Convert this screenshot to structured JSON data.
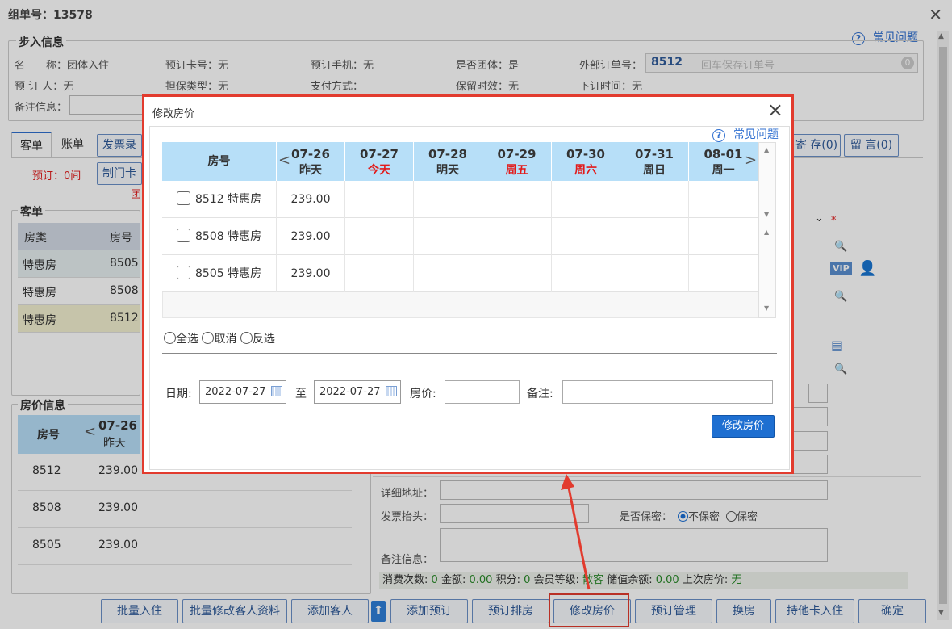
{
  "window": {
    "title": "组单号：13578"
  },
  "help_link": "常见问题",
  "step_info": {
    "title": "步入信息",
    "fields": [
      {
        "label": "名　　称：",
        "value": "团体入住"
      },
      {
        "label": "预订卡号：",
        "value": "无"
      },
      {
        "label": "预订手机：",
        "value": "无"
      },
      {
        "label": "是否团体：",
        "value": "是"
      },
      {
        "label": "外部订单号：",
        "value": "8512"
      },
      {
        "label": "预 订 人：",
        "value": "无"
      },
      {
        "label": "担保类型：",
        "value": "无"
      },
      {
        "label": "支付方式：",
        "value": ""
      },
      {
        "label": "保留时效：",
        "value": "无"
      },
      {
        "label": "下订时间：",
        "value": "无"
      },
      {
        "label": "备注信息：",
        "value": ""
      }
    ],
    "ext_order_placeholder": "回车保存订单号",
    "ext_order_badge": "0"
  },
  "tabs": {
    "guest": "客单",
    "account": "账单",
    "invoice": "发票录",
    "deposit": "寄 存(0)",
    "message": "留 言(0)"
  },
  "reserve_label": "预订：0间",
  "make_card_button": "制门卡",
  "team_flag": "团",
  "guest_list": {
    "title": "客单",
    "headers": [
      "房类",
      "房号"
    ],
    "rows": [
      [
        "特惠房",
        "8505"
      ],
      [
        "特惠房",
        "8508"
      ],
      [
        "特惠房",
        "8512"
      ]
    ]
  },
  "price_info": {
    "title": "房价信息",
    "header_room": "房号",
    "header_date": "07-26",
    "header_day": "昨天",
    "rows": [
      [
        "8512",
        "239.00"
      ],
      [
        "8508",
        "239.00"
      ],
      [
        "8505",
        "239.00"
      ]
    ]
  },
  "right_form": {
    "address_label": "详细地址：",
    "invoice_label": "发票抬头：",
    "secret_label": "是否保密：",
    "secret_options": [
      "不保密",
      "保密"
    ],
    "note_label": "备注信息：",
    "vip": "VIP",
    "stats": [
      {
        "label": "消费次数:",
        "value": "0"
      },
      {
        "label": "金额:",
        "value": "0.00"
      },
      {
        "label": "积分:",
        "value": "0"
      },
      {
        "label": "会员等级:",
        "value": "散客"
      },
      {
        "label": "储值余额:",
        "value": "0.00"
      },
      {
        "label": "上次房价:",
        "value": "无"
      }
    ]
  },
  "bottom_buttons": [
    "批量入住",
    "批量修改客人资料",
    "添加客人",
    "添加预订",
    "预订排房",
    "修改房价",
    "预订管理",
    "换房",
    "持他卡入住",
    "确定"
  ],
  "modal": {
    "title": "修改房价",
    "help": "常见问题",
    "room_header": "房号",
    "dates": [
      {
        "date": "07-26",
        "day": "昨天",
        "red": false
      },
      {
        "date": "07-27",
        "day": "今天",
        "red": true
      },
      {
        "date": "07-28",
        "day": "明天",
        "red": false
      },
      {
        "date": "07-29",
        "day": "周五",
        "red": true
      },
      {
        "date": "07-30",
        "day": "周六",
        "red": true
      },
      {
        "date": "07-31",
        "day": "周日",
        "red": false
      },
      {
        "date": "08-01",
        "day": "周一",
        "red": false
      }
    ],
    "rows": [
      {
        "room": "8512 特惠房",
        "price": "239.00"
      },
      {
        "room": "8508 特惠房",
        "price": "239.00"
      },
      {
        "room": "8505 特惠房",
        "price": "239.00"
      }
    ],
    "select_options": [
      "全选",
      "取消",
      "反选"
    ],
    "date_label": "日期:",
    "start_date": "2022-07-27",
    "to_label": "至",
    "end_date": "2022-07-27",
    "price_label": "房价:",
    "note_label": "备注:",
    "submit": "修改房价"
  }
}
